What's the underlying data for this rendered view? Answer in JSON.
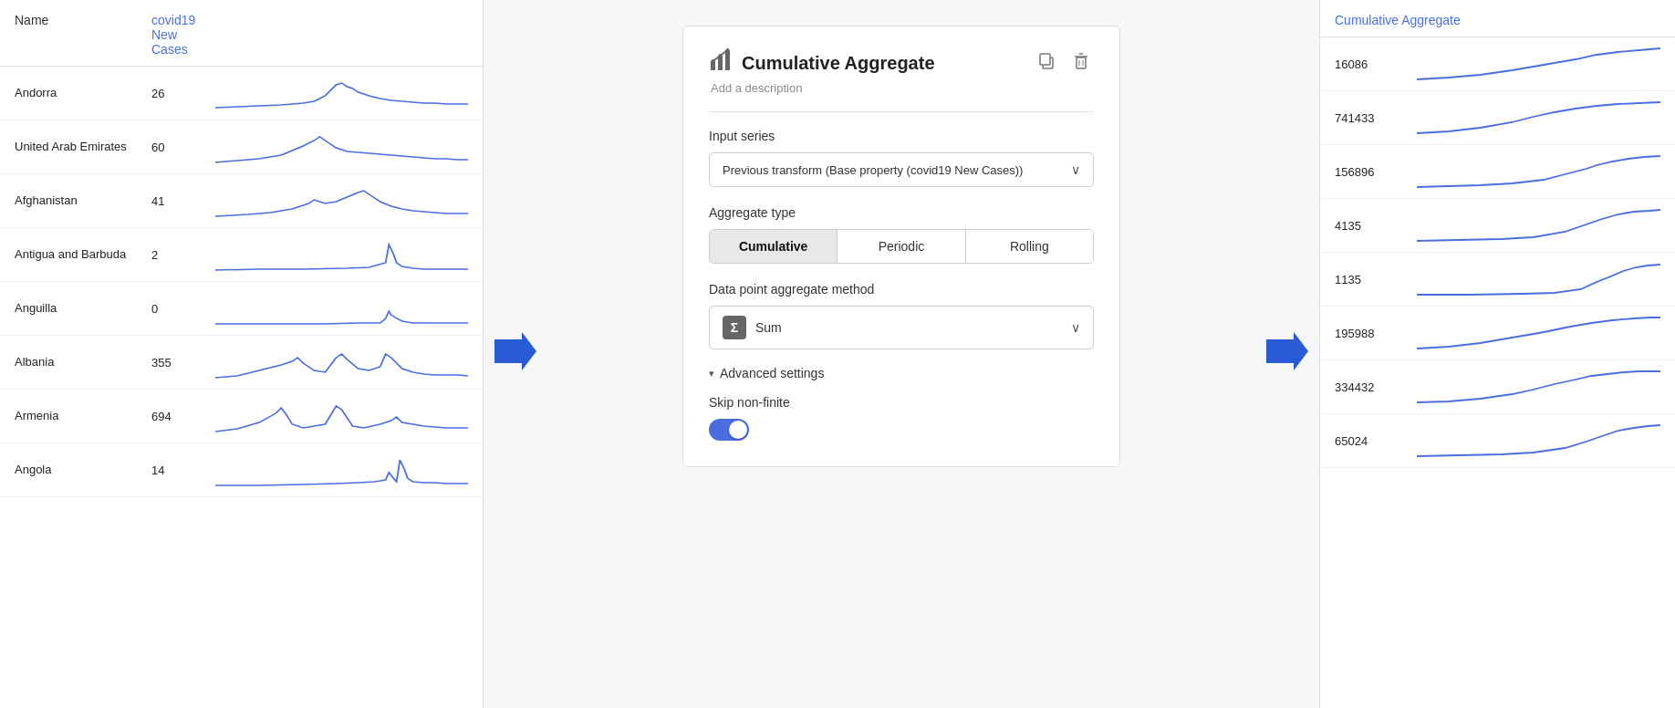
{
  "leftPanel": {
    "headers": {
      "name": "Name",
      "value": "covid19 New Cases"
    },
    "rows": [
      {
        "name": "Andorra",
        "value": "26",
        "sparkType": "andorra"
      },
      {
        "name": "United Arab Emirates",
        "value": "60",
        "sparkType": "uae"
      },
      {
        "name": "Afghanistan",
        "value": "41",
        "sparkType": "afghanistan"
      },
      {
        "name": "Antigua and Barbuda",
        "value": "2",
        "sparkType": "antigua"
      },
      {
        "name": "Anguilla",
        "value": "0",
        "sparkType": "anguilla"
      },
      {
        "name": "Albania",
        "value": "355",
        "sparkType": "albania"
      },
      {
        "name": "Armenia",
        "value": "694",
        "sparkType": "armenia"
      },
      {
        "name": "Angola",
        "value": "14",
        "sparkType": "angola"
      }
    ]
  },
  "card": {
    "title": "Cumulative Aggregate",
    "description": "Add a description",
    "inputSeriesLabel": "Input series",
    "inputSeriesValue": "Previous transform (Base property (covid19 New Cases))",
    "aggregateTypeLabel": "Aggregate type",
    "aggregateButtons": [
      "Cumulative",
      "Periodic",
      "Rolling"
    ],
    "activeAggregate": 0,
    "dpMethodLabel": "Data point aggregate method",
    "dpMethodValue": "Sum",
    "advancedLabel": "Advanced settings",
    "skipLabel": "Skip non-finite",
    "copyIcon": "⧉",
    "deleteIcon": "🗑",
    "chevronDown": "∨",
    "arrowDown": "▾"
  },
  "rightPanel": {
    "header": "Cumulative Aggregate",
    "rows": [
      {
        "value": "16086",
        "sparkType": "r_andorra"
      },
      {
        "value": "741433",
        "sparkType": "r_uae"
      },
      {
        "value": "156896",
        "sparkType": "r_afghanistan"
      },
      {
        "value": "4135",
        "sparkType": "r_antigua"
      },
      {
        "value": "1135",
        "sparkType": "r_anguilla"
      },
      {
        "value": "195988",
        "sparkType": "r_albania"
      },
      {
        "value": "334432",
        "sparkType": "r_armenia"
      },
      {
        "value": "65024",
        "sparkType": "r_angola"
      }
    ]
  },
  "arrows": {
    "leftArrow": "➤",
    "rightArrow": "➤"
  }
}
